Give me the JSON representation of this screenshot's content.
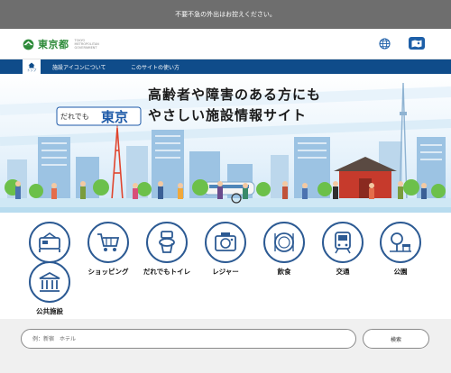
{
  "notice": {
    "text": "不要不急の外出はお控えください。"
  },
  "header": {
    "logo": {
      "name": "東京都",
      "sub": "TOKYO METROPOLITAN GOVERNMENT"
    },
    "globe_icon": "globe-icon",
    "map_icon": "map-icon",
    "brand_color": "#2e8b3a",
    "accent_color": "#1d5fa8"
  },
  "nav": {
    "home_label": "トップ",
    "items": [
      {
        "label": "施設アイコンについて"
      },
      {
        "label": "このサイトの使い方"
      }
    ],
    "color": "#0f4c8a"
  },
  "hero": {
    "badge_small": "だれでも",
    "badge_big": "東京",
    "title_line1": "高齢者や障害のある方にも",
    "title_line2": "やさしい施設情報サイト"
  },
  "categories": [
    {
      "label": "",
      "icon": "hotel-bed-icon"
    },
    {
      "label": "ショッピング",
      "icon": "shopping-cart-icon"
    },
    {
      "label": "だれでもトイレ",
      "icon": "toilet-icon"
    },
    {
      "label": "レジャー",
      "icon": "leisure-icon"
    },
    {
      "label": "飲食",
      "icon": "dining-icon"
    },
    {
      "label": "交通",
      "icon": "train-icon"
    },
    {
      "label": "公園",
      "icon": "park-icon"
    },
    {
      "label": "公共施設",
      "icon": "public-facility-icon"
    }
  ],
  "search": {
    "placeholder": "例：新宿　ホテル",
    "button_label": "検索"
  }
}
